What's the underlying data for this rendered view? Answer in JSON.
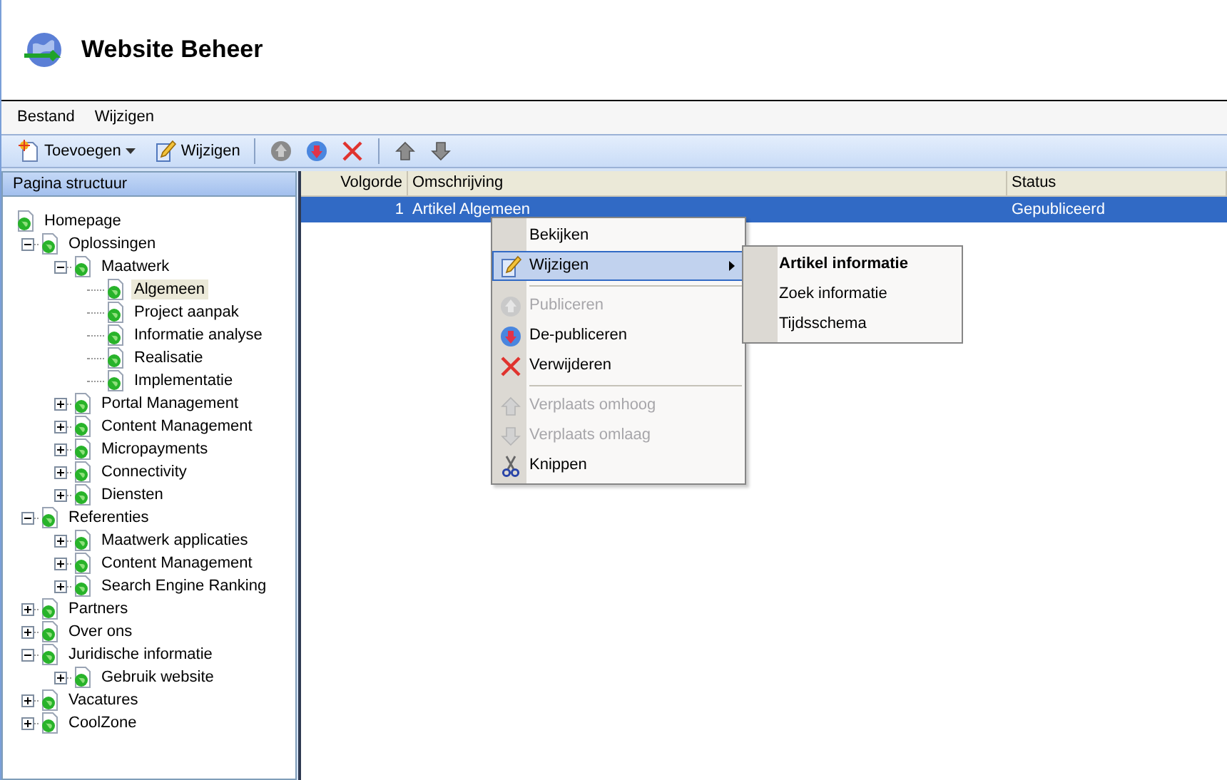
{
  "app": {
    "title": "Website Beheer"
  },
  "menu_bar": [
    "Bestand",
    "Wijzigen"
  ],
  "toolbar": {
    "add_label": "Toevoegen",
    "edit_label": "Wijzigen"
  },
  "tree": {
    "title": "Pagina structuur",
    "nodes": [
      {
        "label": "Homepage",
        "selected": false,
        "children": [
          {
            "label": "Oplossingen",
            "selected": false,
            "expanded": true,
            "children": [
              {
                "label": "Maatwerk",
                "selected": false,
                "expanded": true,
                "children": [
                  {
                    "label": "Algemeen",
                    "selected": true
                  },
                  {
                    "label": "Project aanpak",
                    "selected": false
                  },
                  {
                    "label": "Informatie analyse",
                    "selected": false
                  },
                  {
                    "label": "Realisatie",
                    "selected": false
                  },
                  {
                    "label": "Implementatie",
                    "selected": false
                  }
                ]
              },
              {
                "label": "Portal Management",
                "selected": false,
                "expanded": false
              },
              {
                "label": "Content Management",
                "selected": false,
                "expanded": false
              },
              {
                "label": "Micropayments",
                "selected": false,
                "expanded": false
              },
              {
                "label": "Connectivity",
                "selected": false,
                "expanded": false
              },
              {
                "label": "Diensten",
                "selected": false,
                "expanded": false
              }
            ]
          },
          {
            "label": "Referenties",
            "selected": false,
            "expanded": true,
            "children": [
              {
                "label": "Maatwerk applicaties",
                "selected": false,
                "expanded": false
              },
              {
                "label": "Content Management",
                "selected": false,
                "expanded": false
              },
              {
                "label": "Search Engine Ranking",
                "selected": false,
                "expanded": false
              }
            ]
          },
          {
            "label": "Partners",
            "selected": false,
            "expanded": false
          },
          {
            "label": "Over ons",
            "selected": false,
            "expanded": false
          },
          {
            "label": "Juridische informatie",
            "selected": false,
            "expanded": true,
            "children": [
              {
                "label": "Gebruik website",
                "selected": false,
                "expanded": false
              }
            ]
          },
          {
            "label": "Vacatures",
            "selected": false,
            "expanded": false
          },
          {
            "label": "CoolZone",
            "selected": false,
            "expanded": false
          }
        ]
      }
    ]
  },
  "table": {
    "columns": [
      "Volgorde",
      "Omschrijving",
      "Status"
    ],
    "rows": [
      {
        "cells": [
          "1",
          "Artikel Algemeen",
          "Gepubliceerd"
        ],
        "selected": true
      }
    ]
  },
  "context_menu": {
    "items": [
      {
        "kind": "item",
        "label": "Bekijken",
        "disabled": false,
        "selected": false
      },
      {
        "kind": "item",
        "label": "Wijzigen",
        "disabled": false,
        "selected": true,
        "submenu": true
      },
      {
        "kind": "separator"
      },
      {
        "kind": "item",
        "label": "Publiceren",
        "disabled": true,
        "selected": false
      },
      {
        "kind": "item",
        "label": "De-publiceren",
        "disabled": false,
        "selected": false
      },
      {
        "kind": "item",
        "label": "Verwijderen",
        "disabled": false,
        "selected": false
      },
      {
        "kind": "separator"
      },
      {
        "kind": "item",
        "label": "Verplaats omhoog",
        "disabled": true,
        "selected": false
      },
      {
        "kind": "item",
        "label": "Verplaats omlaag",
        "disabled": true,
        "selected": false
      },
      {
        "kind": "item",
        "label": "Knippen",
        "disabled": false,
        "selected": false
      }
    ]
  },
  "submenu": {
    "items": [
      {
        "label": "Artikel informatie",
        "default": true
      },
      {
        "label": "Zoek informatie",
        "default": false
      },
      {
        "label": "Tijdsschema",
        "default": false
      }
    ]
  }
}
